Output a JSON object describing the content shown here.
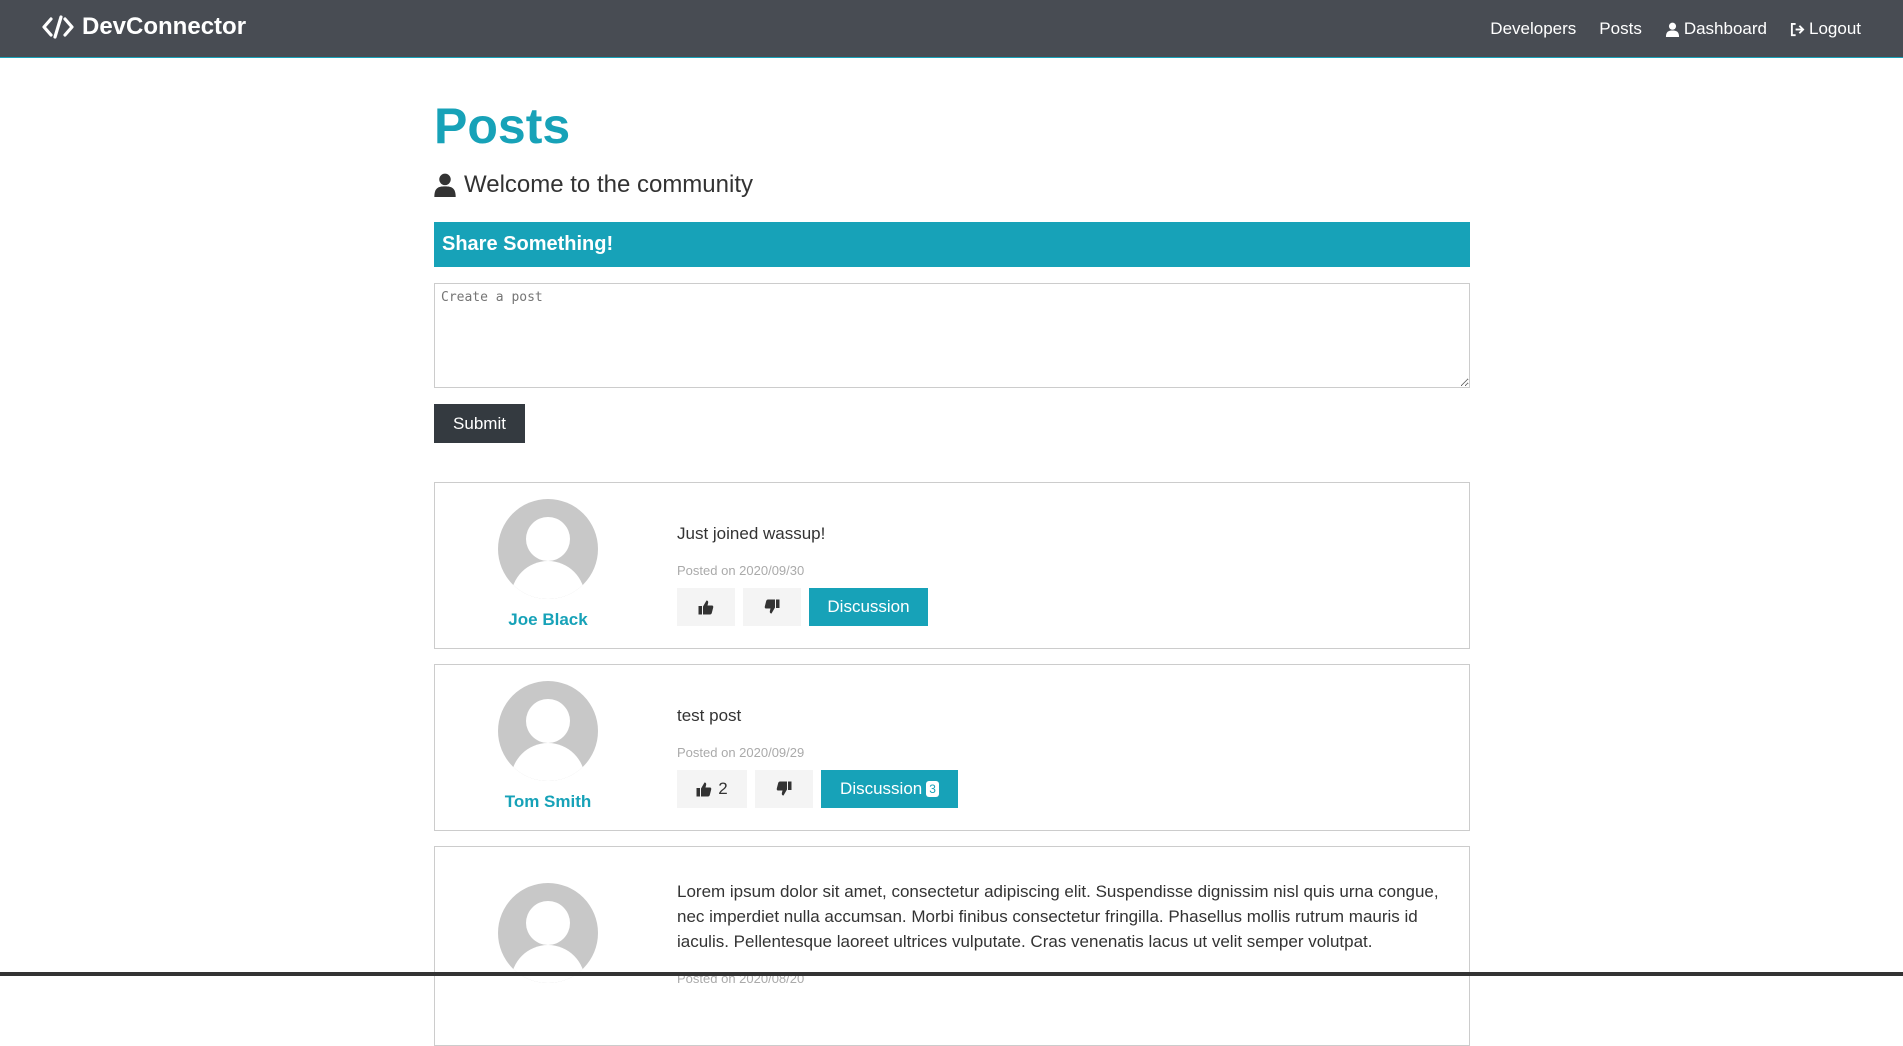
{
  "navbar": {
    "brand": "DevConnector",
    "links": {
      "developers": "Developers",
      "posts": "Posts",
      "dashboard": "Dashboard",
      "logout": "Logout"
    }
  },
  "page": {
    "title": "Posts",
    "lead": "Welcome to the community"
  },
  "form": {
    "header": "Share Something!",
    "textarea_placeholder": "Create a post",
    "submit": "Submit"
  },
  "posts": [
    {
      "author": "Joe Black",
      "text": "Just joined wassup!",
      "date": "Posted on 2020/09/30",
      "likes": "",
      "discussion": "Discussion",
      "comments": ""
    },
    {
      "author": "Tom Smith",
      "text": "test post",
      "date": "Posted on 2020/09/29",
      "likes": "2",
      "discussion": "Discussion",
      "comments": "3"
    },
    {
      "author": "",
      "text": "Lorem ipsum dolor sit amet, consectetur adipiscing elit. Suspendisse dignissim nisl quis urna congue, nec imperdiet nulla accumsan. Morbi finibus consectetur fringilla. Phasellus mollis rutrum mauris id iaculis. Pellentesque laoreet ultrices vulputate. Cras venenatis lacus ut velit semper volutpat.",
      "date": "Posted on 2020/08/20",
      "likes": "",
      "discussion": "",
      "comments": ""
    }
  ],
  "icons": {
    "brand": "code-icon",
    "user": "user-icon",
    "logout": "sign-out-icon",
    "like": "thumbs-up-icon",
    "dislike": "thumbs-down-icon"
  },
  "colors": {
    "primary": "#17a2b8",
    "navbar": "#484c53",
    "dark": "#343a40",
    "light": "#f4f4f4"
  }
}
